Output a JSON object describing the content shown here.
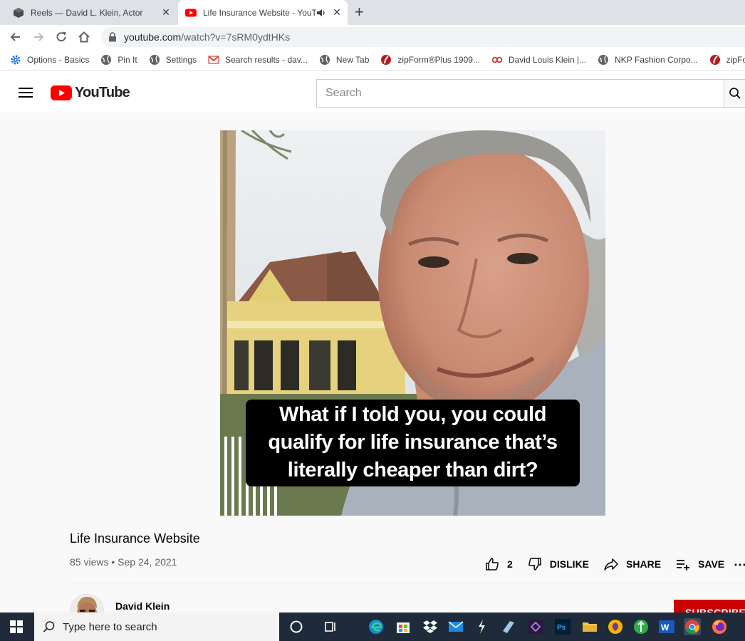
{
  "browser": {
    "tabs": [
      {
        "title": "Reels — David L. Klein, Actor",
        "icon": "cube-icon",
        "active": false
      },
      {
        "title": "Life Insurance Website - YouTube",
        "icon": "youtube-favicon",
        "active": true,
        "audio": true
      }
    ],
    "url_host": "youtube.com",
    "url_path": "/watch?v=7sRM0ydtHKs",
    "bookmarks": [
      {
        "label": "Options - Basics",
        "icon": "gear-icon"
      },
      {
        "label": "Pin It",
        "icon": "globe-icon"
      },
      {
        "label": "Settings",
        "icon": "globe-icon"
      },
      {
        "label": "Search results - dav...",
        "icon": "gmail-icon"
      },
      {
        "label": "New Tab",
        "icon": "globe-icon"
      },
      {
        "label": "zipForm®Plus 1909...",
        "icon": "zipform-icon"
      },
      {
        "label": "David Louis Klein |...",
        "icon": "link-icon"
      },
      {
        "label": "NKP Fashion Corpo...",
        "icon": "globe-icon"
      },
      {
        "label": "zipForm",
        "icon": "zipform-icon"
      }
    ]
  },
  "youtube": {
    "wordmark": "YouTube",
    "search_placeholder": "Search",
    "video": {
      "caption_lines": [
        "What if I told you, you could",
        "qualify for life insurance that’s",
        "literally cheaper than dirt?"
      ]
    },
    "title": "Life Insurance Website",
    "meta": "85 views • Sep 24, 2021",
    "actions": {
      "like_count": "2",
      "dislike": "DISLIKE",
      "share": "SHARE",
      "save": "SAVE"
    },
    "channel_name": "David Klein",
    "subscribe": "SUBSCRIBE"
  },
  "taskbar": {
    "search_placeholder": "Type here to search",
    "pinned": [
      "cortana-icon",
      "task-view-icon",
      "edge-icon",
      "store-icon",
      "dropbox-icon",
      "mail-icon",
      "app-icon",
      "app-icon",
      "visual-studio-icon",
      "photoshop-icon",
      "file-explorer-icon",
      "vpn-icon",
      "app-icon",
      "word-icon",
      "chrome-icon",
      "firefox-icon"
    ]
  },
  "colors": {
    "youtube_red": "#ff0000",
    "subscribe_red": "#cc0000",
    "taskbar": "#1f2b3a"
  }
}
